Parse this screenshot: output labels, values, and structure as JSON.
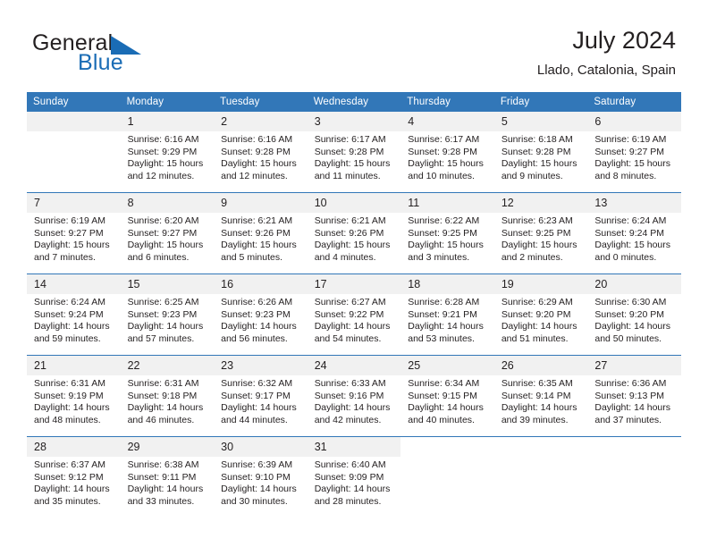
{
  "brand": {
    "name_part1": "General",
    "name_part2": "Blue",
    "flag_icon": "blue-triangle-flag-icon",
    "accent_color": "#1a6cb5"
  },
  "header": {
    "title": "July 2024",
    "subtitle": "Llado, Catalonia, Spain"
  },
  "theme": {
    "header_bg": "#3277b8",
    "daynum_bg": "#f1f1f1",
    "text": "#231f20"
  },
  "weekday_headers": [
    "Sunday",
    "Monday",
    "Tuesday",
    "Wednesday",
    "Thursday",
    "Friday",
    "Saturday"
  ],
  "weeks": [
    [
      {
        "day": "",
        "blank": true,
        "empty_shaded": true,
        "sunrise": "",
        "sunset": "",
        "daylight_line1": "",
        "daylight_line2": ""
      },
      {
        "day": "1",
        "sunrise": "Sunrise: 6:16 AM",
        "sunset": "Sunset: 9:29 PM",
        "daylight_line1": "Daylight: 15 hours",
        "daylight_line2": "and 12 minutes."
      },
      {
        "day": "2",
        "sunrise": "Sunrise: 6:16 AM",
        "sunset": "Sunset: 9:28 PM",
        "daylight_line1": "Daylight: 15 hours",
        "daylight_line2": "and 12 minutes."
      },
      {
        "day": "3",
        "sunrise": "Sunrise: 6:17 AM",
        "sunset": "Sunset: 9:28 PM",
        "daylight_line1": "Daylight: 15 hours",
        "daylight_line2": "and 11 minutes."
      },
      {
        "day": "4",
        "sunrise": "Sunrise: 6:17 AM",
        "sunset": "Sunset: 9:28 PM",
        "daylight_line1": "Daylight: 15 hours",
        "daylight_line2": "and 10 minutes."
      },
      {
        "day": "5",
        "sunrise": "Sunrise: 6:18 AM",
        "sunset": "Sunset: 9:28 PM",
        "daylight_line1": "Daylight: 15 hours",
        "daylight_line2": "and 9 minutes."
      },
      {
        "day": "6",
        "sunrise": "Sunrise: 6:19 AM",
        "sunset": "Sunset: 9:27 PM",
        "daylight_line1": "Daylight: 15 hours",
        "daylight_line2": "and 8 minutes."
      }
    ],
    [
      {
        "day": "7",
        "sunrise": "Sunrise: 6:19 AM",
        "sunset": "Sunset: 9:27 PM",
        "daylight_line1": "Daylight: 15 hours",
        "daylight_line2": "and 7 minutes."
      },
      {
        "day": "8",
        "sunrise": "Sunrise: 6:20 AM",
        "sunset": "Sunset: 9:27 PM",
        "daylight_line1": "Daylight: 15 hours",
        "daylight_line2": "and 6 minutes."
      },
      {
        "day": "9",
        "sunrise": "Sunrise: 6:21 AM",
        "sunset": "Sunset: 9:26 PM",
        "daylight_line1": "Daylight: 15 hours",
        "daylight_line2": "and 5 minutes."
      },
      {
        "day": "10",
        "sunrise": "Sunrise: 6:21 AM",
        "sunset": "Sunset: 9:26 PM",
        "daylight_line1": "Daylight: 15 hours",
        "daylight_line2": "and 4 minutes."
      },
      {
        "day": "11",
        "sunrise": "Sunrise: 6:22 AM",
        "sunset": "Sunset: 9:25 PM",
        "daylight_line1": "Daylight: 15 hours",
        "daylight_line2": "and 3 minutes."
      },
      {
        "day": "12",
        "sunrise": "Sunrise: 6:23 AM",
        "sunset": "Sunset: 9:25 PM",
        "daylight_line1": "Daylight: 15 hours",
        "daylight_line2": "and 2 minutes."
      },
      {
        "day": "13",
        "sunrise": "Sunrise: 6:24 AM",
        "sunset": "Sunset: 9:24 PM",
        "daylight_line1": "Daylight: 15 hours",
        "daylight_line2": "and 0 minutes."
      }
    ],
    [
      {
        "day": "14",
        "sunrise": "Sunrise: 6:24 AM",
        "sunset": "Sunset: 9:24 PM",
        "daylight_line1": "Daylight: 14 hours",
        "daylight_line2": "and 59 minutes."
      },
      {
        "day": "15",
        "sunrise": "Sunrise: 6:25 AM",
        "sunset": "Sunset: 9:23 PM",
        "daylight_line1": "Daylight: 14 hours",
        "daylight_line2": "and 57 minutes."
      },
      {
        "day": "16",
        "sunrise": "Sunrise: 6:26 AM",
        "sunset": "Sunset: 9:23 PM",
        "daylight_line1": "Daylight: 14 hours",
        "daylight_line2": "and 56 minutes."
      },
      {
        "day": "17",
        "sunrise": "Sunrise: 6:27 AM",
        "sunset": "Sunset: 9:22 PM",
        "daylight_line1": "Daylight: 14 hours",
        "daylight_line2": "and 54 minutes."
      },
      {
        "day": "18",
        "sunrise": "Sunrise: 6:28 AM",
        "sunset": "Sunset: 9:21 PM",
        "daylight_line1": "Daylight: 14 hours",
        "daylight_line2": "and 53 minutes."
      },
      {
        "day": "19",
        "sunrise": "Sunrise: 6:29 AM",
        "sunset": "Sunset: 9:20 PM",
        "daylight_line1": "Daylight: 14 hours",
        "daylight_line2": "and 51 minutes."
      },
      {
        "day": "20",
        "sunrise": "Sunrise: 6:30 AM",
        "sunset": "Sunset: 9:20 PM",
        "daylight_line1": "Daylight: 14 hours",
        "daylight_line2": "and 50 minutes."
      }
    ],
    [
      {
        "day": "21",
        "sunrise": "Sunrise: 6:31 AM",
        "sunset": "Sunset: 9:19 PM",
        "daylight_line1": "Daylight: 14 hours",
        "daylight_line2": "and 48 minutes."
      },
      {
        "day": "22",
        "sunrise": "Sunrise: 6:31 AM",
        "sunset": "Sunset: 9:18 PM",
        "daylight_line1": "Daylight: 14 hours",
        "daylight_line2": "and 46 minutes."
      },
      {
        "day": "23",
        "sunrise": "Sunrise: 6:32 AM",
        "sunset": "Sunset: 9:17 PM",
        "daylight_line1": "Daylight: 14 hours",
        "daylight_line2": "and 44 minutes."
      },
      {
        "day": "24",
        "sunrise": "Sunrise: 6:33 AM",
        "sunset": "Sunset: 9:16 PM",
        "daylight_line1": "Daylight: 14 hours",
        "daylight_line2": "and 42 minutes."
      },
      {
        "day": "25",
        "sunrise": "Sunrise: 6:34 AM",
        "sunset": "Sunset: 9:15 PM",
        "daylight_line1": "Daylight: 14 hours",
        "daylight_line2": "and 40 minutes."
      },
      {
        "day": "26",
        "sunrise": "Sunrise: 6:35 AM",
        "sunset": "Sunset: 9:14 PM",
        "daylight_line1": "Daylight: 14 hours",
        "daylight_line2": "and 39 minutes."
      },
      {
        "day": "27",
        "sunrise": "Sunrise: 6:36 AM",
        "sunset": "Sunset: 9:13 PM",
        "daylight_line1": "Daylight: 14 hours",
        "daylight_line2": "and 37 minutes."
      }
    ],
    [
      {
        "day": "28",
        "sunrise": "Sunrise: 6:37 AM",
        "sunset": "Sunset: 9:12 PM",
        "daylight_line1": "Daylight: 14 hours",
        "daylight_line2": "and 35 minutes."
      },
      {
        "day": "29",
        "sunrise": "Sunrise: 6:38 AM",
        "sunset": "Sunset: 9:11 PM",
        "daylight_line1": "Daylight: 14 hours",
        "daylight_line2": "and 33 minutes."
      },
      {
        "day": "30",
        "sunrise": "Sunrise: 6:39 AM",
        "sunset": "Sunset: 9:10 PM",
        "daylight_line1": "Daylight: 14 hours",
        "daylight_line2": "and 30 minutes."
      },
      {
        "day": "31",
        "sunrise": "Sunrise: 6:40 AM",
        "sunset": "Sunset: 9:09 PM",
        "daylight_line1": "Daylight: 14 hours",
        "daylight_line2": "and 28 minutes."
      },
      {
        "day": "",
        "blank": true,
        "sunrise": "",
        "sunset": "",
        "daylight_line1": "",
        "daylight_line2": ""
      },
      {
        "day": "",
        "blank": true,
        "sunrise": "",
        "sunset": "",
        "daylight_line1": "",
        "daylight_line2": ""
      },
      {
        "day": "",
        "blank": true,
        "sunrise": "",
        "sunset": "",
        "daylight_line1": "",
        "daylight_line2": ""
      }
    ]
  ]
}
